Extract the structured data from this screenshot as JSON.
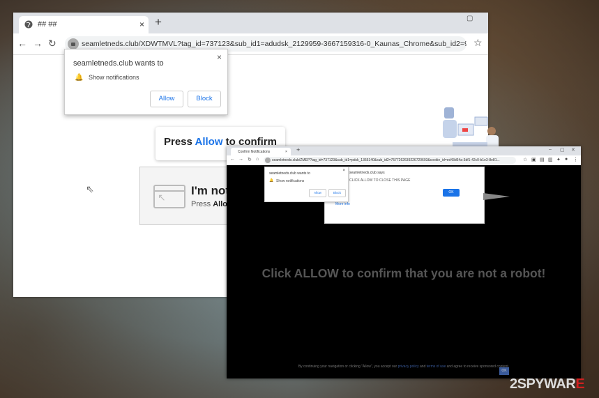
{
  "browser_main": {
    "tab_title": "## ##",
    "tab_close": "×",
    "new_tab": "+",
    "url": "seamletneds.club/XDWTMVL?tag_id=737123&sub_id1=adudsk_2129959-3667159316-0_Kaunas_Chrome&sub_id2=943...",
    "permission_popup": {
      "title": "seamletneds.club wants to",
      "item": "Show notifications",
      "allow_label": "Allow",
      "block_label": "Block",
      "close": "×"
    },
    "press_allow": {
      "prefix": "Press",
      "highlight": "Allow",
      "suffix": "to confirm"
    },
    "captcha": {
      "big_text": "I'm not a",
      "small_prefix": "Press",
      "small_bold": "Allow",
      "small_suffix": "t"
    }
  },
  "browser_second": {
    "tab_title": "Confirm Notifications",
    "tab_close": "×",
    "new_tab": "+",
    "url": "seamletneds.club/ZMEP?tag_id=737123&sub_id1=pdsk_1365140&sub_id2=7577262639226720603&cookie_id=ed43d64a-3df1-42c0-b1e3-8e81...",
    "permission_popup": {
      "title": "seamletneds.club wants to",
      "item": "Show notifications",
      "allow_label": "Allow",
      "block_label": "Block",
      "close": "×"
    },
    "alert": {
      "header": "seamletneds.club says",
      "message": "CLICK ALLOW TO CLOSE THIS PAGE",
      "ok_label": "OK",
      "more_info": "More info"
    },
    "robot_text": "Click ALLOW to confirm that you are not a robot!",
    "footer_prefix": "By continuing your navigation or clicking \"Allow\", you accept our",
    "footer_link1": "privacy policy",
    "footer_and": "and",
    "footer_link2": "terms of use",
    "footer_suffix": "and agree to receive sponsored content.",
    "footer_ok": "OK"
  },
  "watermark": {
    "prefix": "2SPYWAR",
    "accent": "E"
  }
}
